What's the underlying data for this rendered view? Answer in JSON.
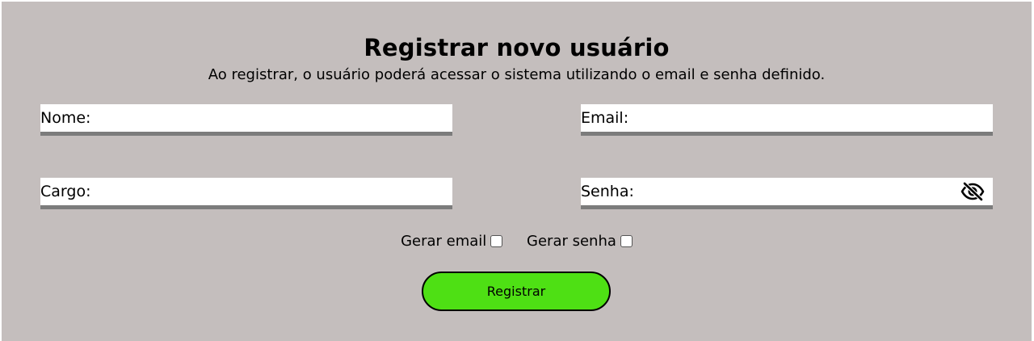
{
  "form": {
    "title": "Registrar novo usuário",
    "subtitle": "Ao registrar, o usuário poderá acessar o sistema utilizando o email e senha definido.",
    "fields": {
      "nome": {
        "label": "Nome:"
      },
      "email": {
        "label": "Email:"
      },
      "cargo": {
        "label": "Cargo:"
      },
      "senha": {
        "label": "Senha:",
        "toggle_icon": "eye-slash-icon"
      }
    },
    "checkboxes": {
      "gerar_email": {
        "label": "Gerar email",
        "checked": false
      },
      "gerar_senha": {
        "label": "Gerar senha",
        "checked": false
      }
    },
    "submit_label": "Registrar"
  },
  "colors": {
    "panel_background": "#c4bebd",
    "input_background": "#ffffff",
    "input_underline": "#7c7c7c",
    "button_background": "#4ee014",
    "button_border": "#000000"
  }
}
